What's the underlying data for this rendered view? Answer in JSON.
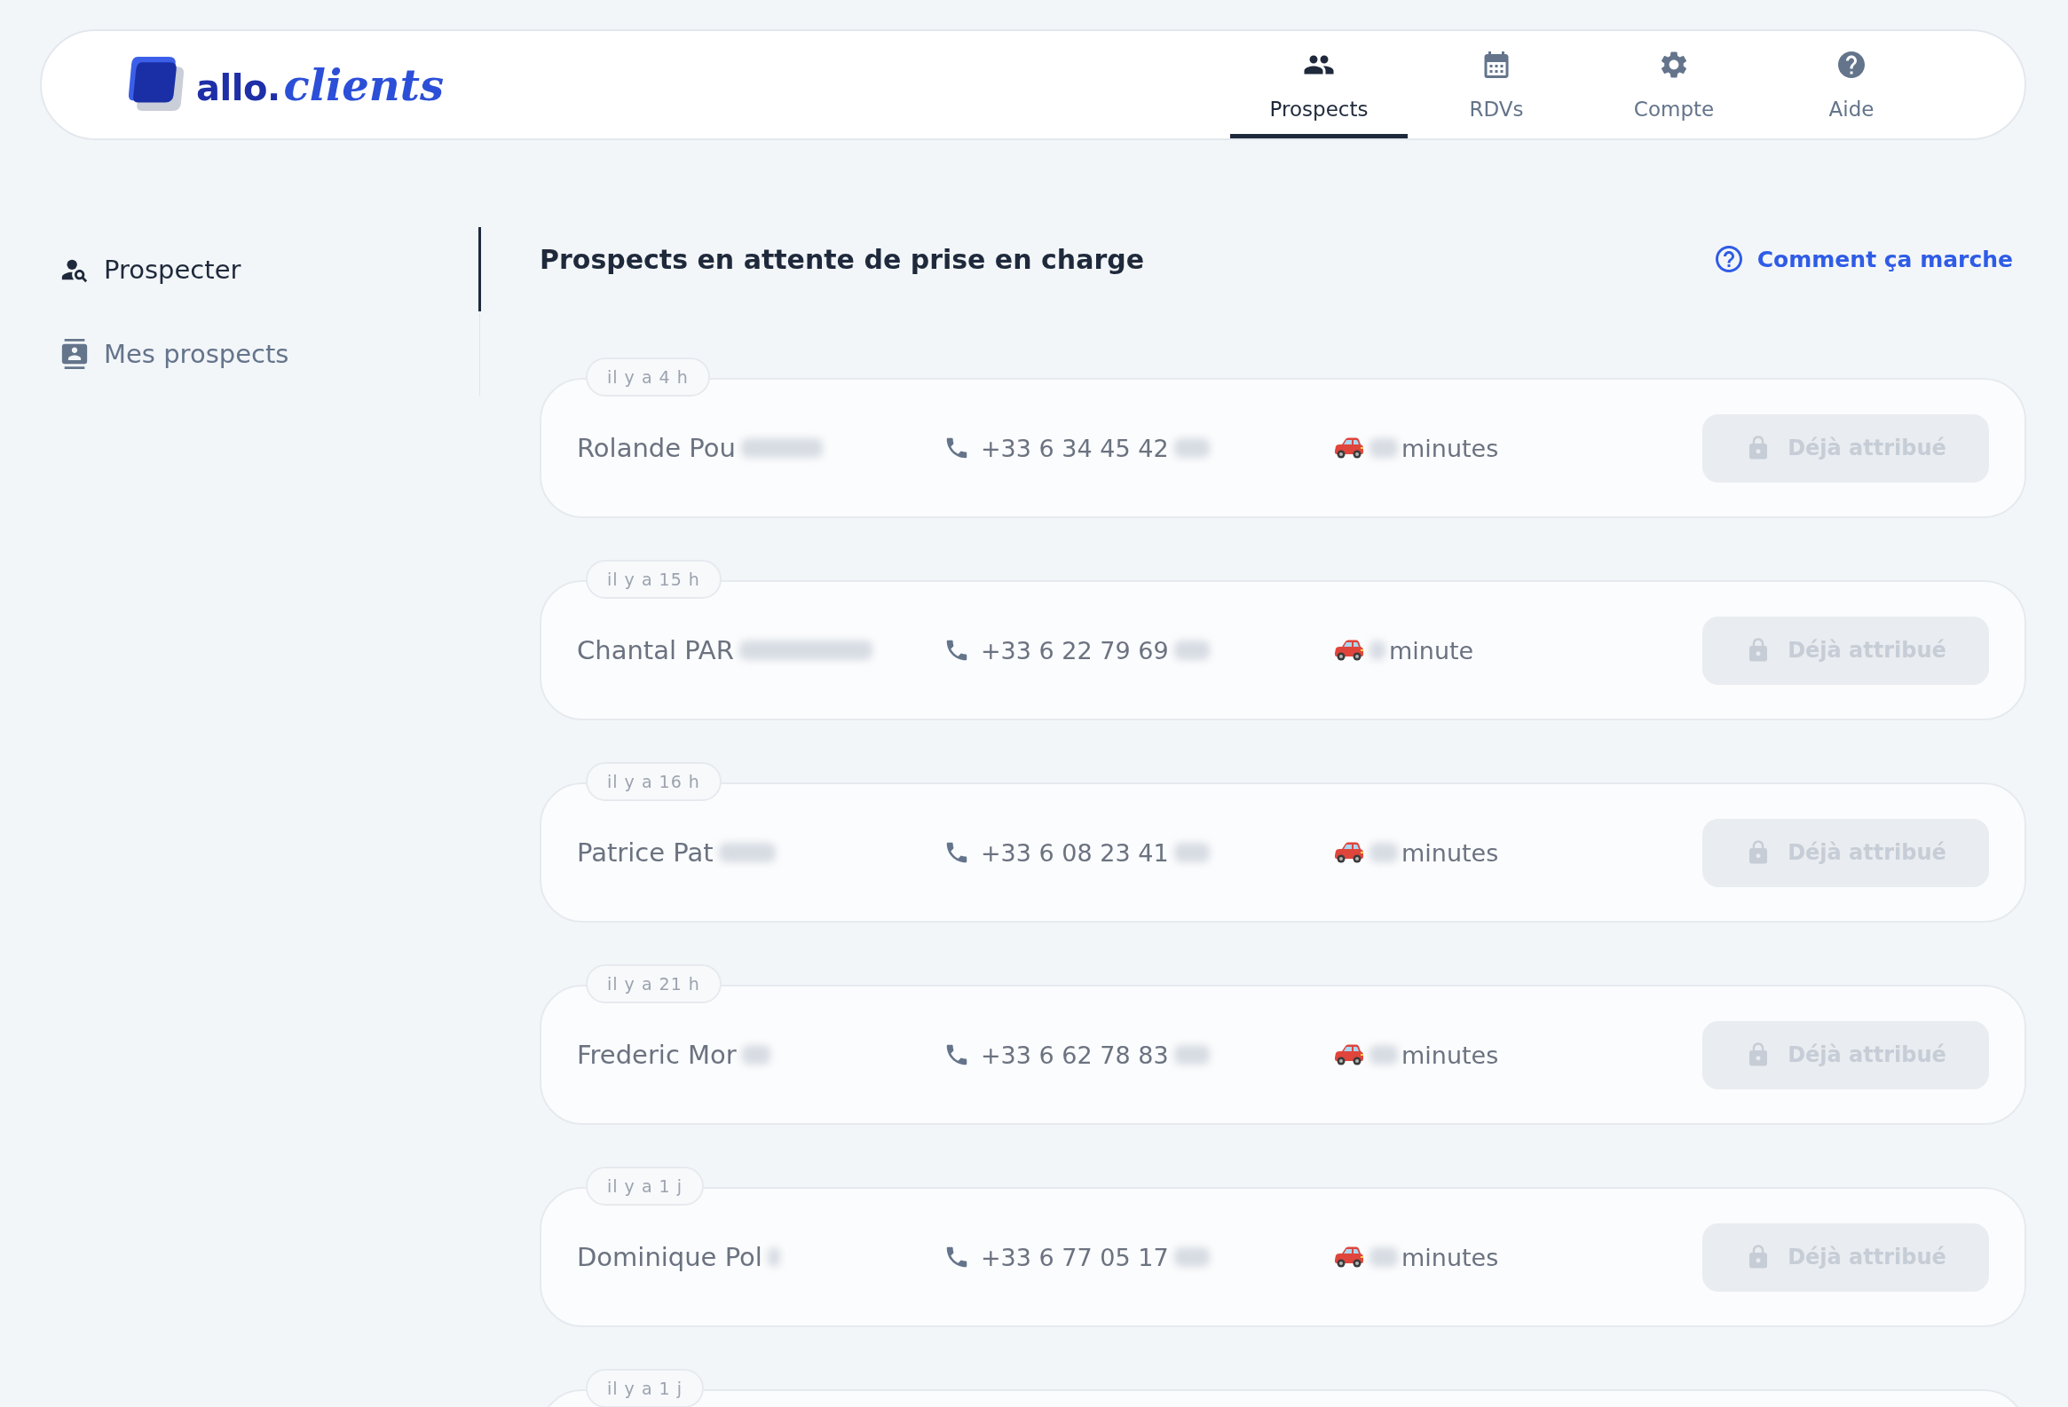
{
  "header": {
    "logo": {
      "prefix": "allo.",
      "suffix": "clients"
    },
    "nav": [
      {
        "label": "Prospects",
        "selected": true
      },
      {
        "label": "RDVs",
        "selected": false
      },
      {
        "label": "Compte",
        "selected": false
      },
      {
        "label": "Aide",
        "selected": false
      }
    ]
  },
  "sidebar": {
    "items": [
      {
        "label": "Prospecter",
        "selected": true
      },
      {
        "label": "Mes prospects",
        "selected": false
      }
    ]
  },
  "main": {
    "title": "Prospects en attente de prise en charge",
    "help_link": "Comment ça marche",
    "prospects": [
      {
        "time_ago": "il y a 4 h",
        "name": "Rolande Pou",
        "phone": "+33 6 34 45 42",
        "travel_unit": "minutes",
        "redacted": true,
        "action": {
          "label": "Déjà attribué",
          "disabled": true
        }
      },
      {
        "time_ago": "il y a 15 h",
        "name": "Chantal PAR",
        "phone": "+33 6 22 79 69",
        "travel_unit": "minute",
        "redacted": true,
        "action": {
          "label": "Déjà attribué",
          "disabled": true
        }
      },
      {
        "time_ago": "il y a 16 h",
        "name": "Patrice Pat",
        "phone": "+33 6 08 23 41",
        "travel_unit": "minutes",
        "redacted": true,
        "action": {
          "label": "Déjà attribué",
          "disabled": true
        }
      },
      {
        "time_ago": "il y a 21 h",
        "name": "Frederic Mor",
        "phone": "+33 6 62 78 83",
        "travel_unit": "minutes",
        "redacted": true,
        "action": {
          "label": "Déjà attribué",
          "disabled": true
        }
      },
      {
        "time_ago": "il y a 1 j",
        "name": "Dominique Pol",
        "phone": "+33 6 77 05 17",
        "travel_unit": "minutes",
        "redacted": true,
        "action": {
          "label": "Déjà attribué",
          "disabled": true
        }
      },
      {
        "time_ago": "il y a 1 j"
      }
    ]
  }
}
